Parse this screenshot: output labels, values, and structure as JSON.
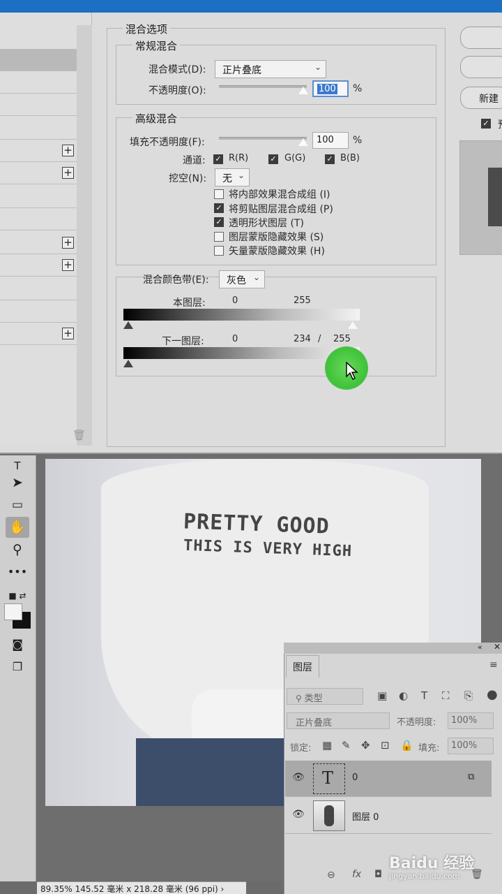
{
  "dialog": {
    "title": "混合选项",
    "general": {
      "title": "常规混合",
      "blend_mode_label": "混合模式(D):",
      "blend_mode_value": "正片叠底",
      "opacity_label": "不透明度(O):",
      "opacity_value": "100",
      "percent": "%"
    },
    "advanced": {
      "title": "高级混合",
      "fill_opacity_label": "填充不透明度(F):",
      "fill_opacity_value": "100",
      "percent": "%",
      "channels_label": "通道:",
      "channels": [
        {
          "label": "R(R)",
          "checked": true
        },
        {
          "label": "G(G)",
          "checked": true
        },
        {
          "label": "B(B)",
          "checked": true
        }
      ],
      "knockout_label": "挖空(N):",
      "knockout_value": "无",
      "options": [
        {
          "label": "将内部效果混合成组 (I)",
          "checked": false
        },
        {
          "label": "将剪贴图层混合成组 (P)",
          "checked": true
        },
        {
          "label": "透明形状图层 (T)",
          "checked": true
        },
        {
          "label": "图层蒙版隐藏效果 (S)",
          "checked": false
        },
        {
          "label": "矢量蒙版隐藏效果 (H)",
          "checked": false
        }
      ]
    },
    "blend_if": {
      "label": "混合颜色带(E):",
      "value": "灰色",
      "this_layer_label": "本图层:",
      "this_layer_low": "0",
      "this_layer_high": "255",
      "underlying_label": "下一图层:",
      "underlying_low": "0",
      "underlying_split_low": "234",
      "underlying_sep": "/",
      "underlying_split_high": "255"
    },
    "right_buttons": [
      "",
      "",
      "新建"
    ],
    "right_checkbox_label": "预"
  },
  "canvas": {
    "shirt_line1": "PRETTY GOOD",
    "shirt_line2": "THIS IS VERY HIGH"
  },
  "layers_panel": {
    "tab": "图层",
    "filter_label": "类型",
    "blend_mode": "正片叠底",
    "opacity_label": "不透明度:",
    "opacity_value": "100%",
    "lock_label": "锁定:",
    "fill_label": "填充:",
    "fill_value": "100%",
    "layers": [
      {
        "name": "0",
        "type": "text",
        "selected": true
      },
      {
        "name": "图层 0",
        "type": "image",
        "selected": false
      }
    ]
  },
  "status_bar": "89.35%  145.52 毫米 x 218.28 毫米 (96 ppi)  ›",
  "watermark": {
    "logo": "Baidu 经验",
    "url": "jingyan.baidu.com"
  },
  "colors": {
    "click_indicator": "#40c23a",
    "title_bar": "#1c6fc2",
    "focus": "#3a79d1"
  }
}
